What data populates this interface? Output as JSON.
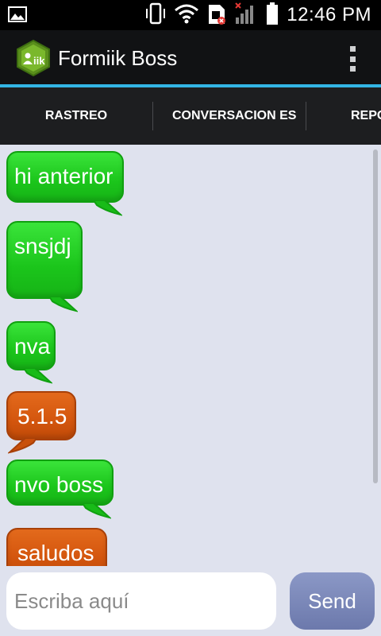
{
  "status_bar": {
    "time": "12:46 PM",
    "icons": [
      "image-icon",
      "vibrate-icon",
      "wifi-icon",
      "sim-error-icon",
      "signal-icon",
      "battery-icon"
    ]
  },
  "action_bar": {
    "title": "Formiik Boss",
    "logo_icon": "formiik-logo-icon",
    "menu_icon": "overflow-menu-icon"
  },
  "tabs": [
    {
      "label": "RASTREO",
      "selected": true
    },
    {
      "label": "CONVERSACION ES",
      "selected": false
    },
    {
      "label": "REPO",
      "selected": false
    }
  ],
  "messages": [
    {
      "text": "hi anterior",
      "color": "green"
    },
    {
      "text": "snsjdj",
      "color": "green"
    },
    {
      "text": "nva",
      "color": "green"
    },
    {
      "text": "5.1.5",
      "color": "orange"
    },
    {
      "text": "nvo boss",
      "color": "green"
    },
    {
      "text": "saludos",
      "color": "orange"
    }
  ],
  "input": {
    "placeholder": "Escriba aquí",
    "value": ""
  },
  "send_label": "Send",
  "colors": {
    "accent": "#33b5e5",
    "green_bubble": "#1bc51b",
    "orange_bubble": "#d4560e",
    "chat_background": "#dfe2ee",
    "send_button": "#7a87b8"
  }
}
